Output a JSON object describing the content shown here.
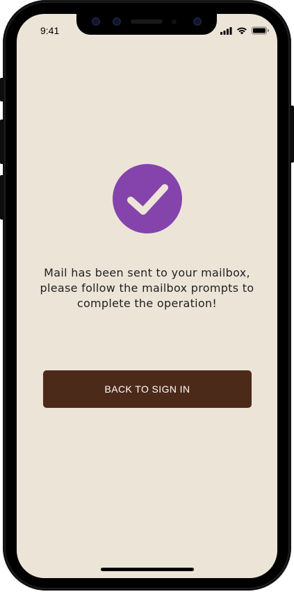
{
  "status_bar": {
    "time": "9:41",
    "icons": [
      "signal-icon",
      "wifi-icon",
      "battery-icon"
    ]
  },
  "success": {
    "icon": "checkmark-icon",
    "circle_color": "#8544ab",
    "message_line1": "Mail has been sent to your mailbox,",
    "message_line2": "please follow the mailbox prompts to",
    "message_line3": "complete the operation!"
  },
  "actions": {
    "back_to_sign_in_label": "BACK TO SIGN IN",
    "button_color": "#4c2a1a"
  },
  "theme": {
    "background": "#ede4d8"
  }
}
